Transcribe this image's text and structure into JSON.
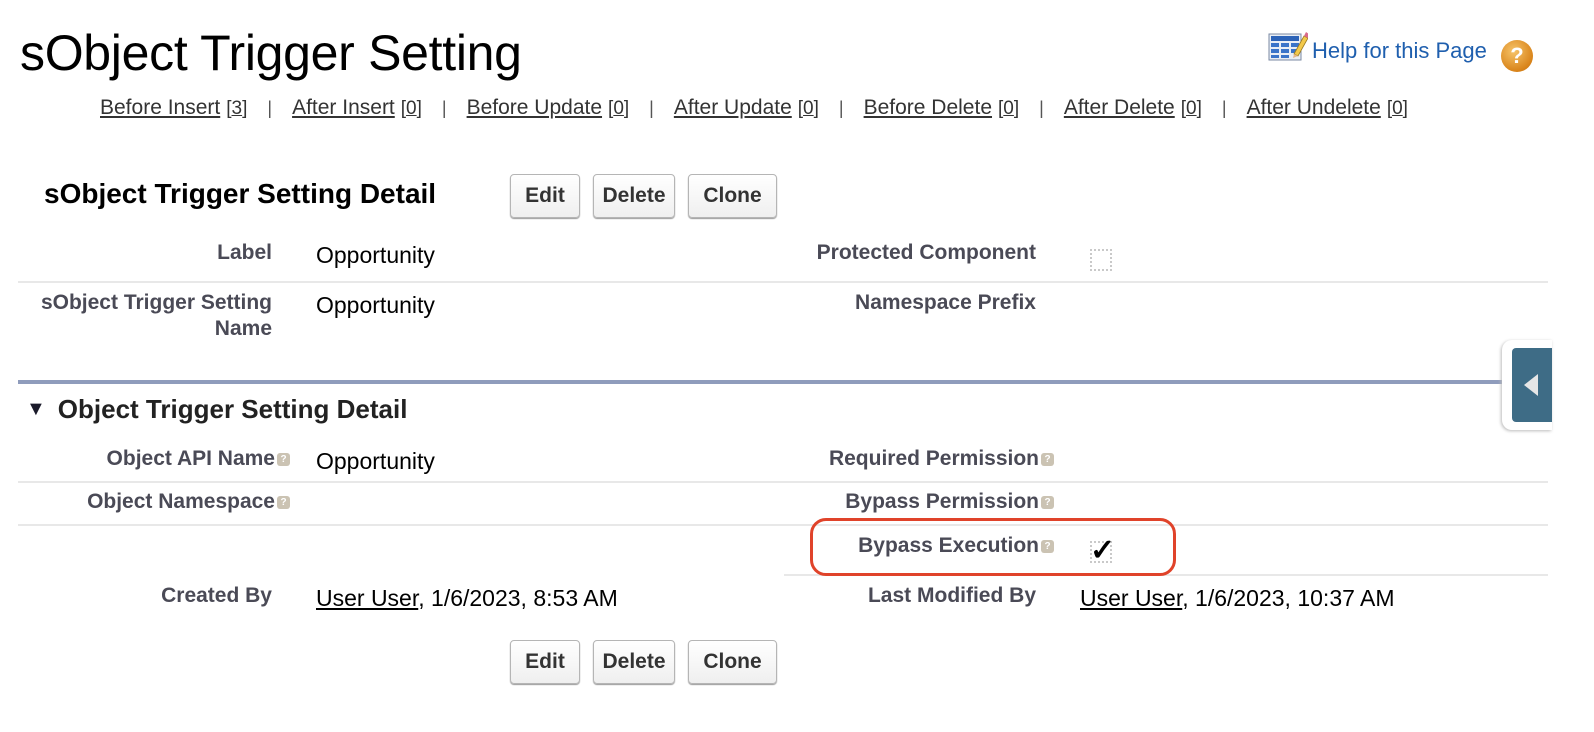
{
  "page": {
    "title": "sObject Trigger Setting",
    "help_link": "Help for this Page",
    "help_icon": "question-circle-icon",
    "sheet_icon": "spreadsheet-edit-icon"
  },
  "trigger_nav": [
    {
      "label": "Before Insert",
      "count": "3"
    },
    {
      "label": "After Insert",
      "count": "0"
    },
    {
      "label": "Before Update",
      "count": "0"
    },
    {
      "label": "After Update",
      "count": "0"
    },
    {
      "label": "Before Delete",
      "count": "0"
    },
    {
      "label": "After Delete",
      "count": "0"
    },
    {
      "label": "After Undelete",
      "count": "0"
    }
  ],
  "detail": {
    "heading": "sObject Trigger Setting Detail",
    "buttons": {
      "edit": "Edit",
      "delete": "Delete",
      "clone": "Clone"
    },
    "fields": {
      "label_label": "Label",
      "label_value": "Opportunity",
      "name_label": "sObject Trigger Setting Name",
      "name_label_line1": "sObject Trigger Setting",
      "name_label_line2": "Name",
      "name_value": "Opportunity",
      "protected_label": "Protected Component",
      "protected_checked": false,
      "namespace_prefix_label": "Namespace Prefix",
      "namespace_prefix_value": ""
    }
  },
  "section": {
    "heading": "Object Trigger Setting Detail",
    "collapse_icon": "triangle-down-icon",
    "fields": {
      "object_api_name_label": "Object API Name",
      "object_api_name_value": "Opportunity",
      "object_namespace_label": "Object Namespace",
      "object_namespace_value": "",
      "required_permission_label": "Required Permission",
      "required_permission_value": "",
      "bypass_permission_label": "Bypass Permission",
      "bypass_permission_value": "",
      "bypass_execution_label": "Bypass Execution",
      "bypass_execution_checked": true
    }
  },
  "audit": {
    "created_by_label": "Created By",
    "created_by_user": "User User",
    "created_by_date": ", 1/6/2023, 8:53 AM",
    "last_modified_label": "Last Modified By",
    "last_modified_user": "User User",
    "last_modified_date": ", 1/6/2023, 10:37 AM"
  },
  "help_tooltip_glyph": "?",
  "checkmark_glyph": "✓",
  "colors": {
    "link_blue": "#1f5fae",
    "section_bar": "#8f9cbc",
    "highlight_red": "#e0432a",
    "side_tab": "#3e6c86"
  }
}
